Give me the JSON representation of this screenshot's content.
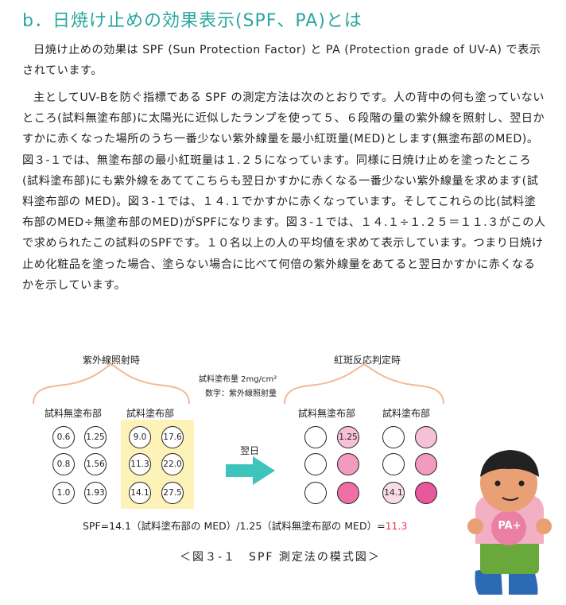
{
  "title": "b．日焼け止めの効果表示(SPF、PA)とは",
  "paragraphs": [
    "日焼け止めの効果は SPF (Sun Protection Factor) と PA (Protection grade of UV-A) で表示されています。",
    "主としてUV-Bを防ぐ指標である SPF の測定方法は次のとおりです。人の背中の何も塗っていないところ(試料無塗布部)に太陽光に近似したランプを使って５、６段階の量の紫外線を照射し、翌日かすかに赤くなった場所のうち一番少ない紫外線量を最小紅斑量(MED)とします(無塗布部のMED)。図３-１では、無塗布部の最小紅斑量は１.２５になっています。同様に日焼け止めを塗ったところ(試料塗布部)にも紫外線をあててこちらも翌日かすかに赤くなる一番少ない紫外線量を求めます(試料塗布部の MED)。図３-１では、１４.１でかすかに赤くなっています。そしてこれらの比(試料塗布部のMED÷無塗布部のMED)がSPFになります。図３-１では、１４.１÷１.２５＝１１.３がこの人で求められたこの試料のSPFです。１０名以上の人の平均値を求めて表示しています。つまり日焼け止め化粧品を塗った場合、塗らない場合に比べて何倍の紫外線量をあてると翌日かすかに赤くなるかを示しています。"
  ],
  "figure": {
    "left_heading": "紫外線照射時",
    "right_heading": "紅斑反応判定時",
    "note_amount": "試料塗布量 2mg/cm²",
    "note_numbers": "数字：紫外線照射量",
    "untreated_label": "試料無塗布部",
    "treated_label": "試料塗布部",
    "untreated_doses": [
      "0.6",
      "1.25",
      "0.8",
      "1.56",
      "1.0",
      "1.93"
    ],
    "treated_doses": [
      "9.0",
      "17.6",
      "11.3",
      "22.0",
      "14.1",
      "27.5"
    ],
    "arrow_label": "翌日",
    "result_untreated_label": "試料無塗布部",
    "result_treated_label": "試料塗布部",
    "result_untreated_text": [
      "",
      "1.25",
      "",
      "",
      "",
      ""
    ],
    "result_treated_text": [
      "",
      "",
      "",
      "",
      "14.1",
      ""
    ],
    "result_untreated_colors": [
      "#ffffff",
      "#f6c1d8",
      "#ffffff",
      "#f29ac0",
      "#ffffff",
      "#ee6ea6"
    ],
    "result_treated_colors": [
      "#ffffff",
      "#f6c1d8",
      "#ffffff",
      "#f29ac0",
      "#f9dbe8",
      "#e8589a"
    ],
    "formula_main": "SPF=14.1（試料塗布部の MED）/1.25（試料無塗布部の MED）=",
    "formula_result": "11.3",
    "caption": "＜図３-１　SPF 測定法の模式図＞",
    "mascot_badge": "PA+"
  },
  "colors": {
    "title": "#2aa7a0",
    "brace": "#f2b896",
    "arrow": "#3fc3bd",
    "highlight": "#fdf3b8",
    "formula_result": "#e8394a"
  }
}
